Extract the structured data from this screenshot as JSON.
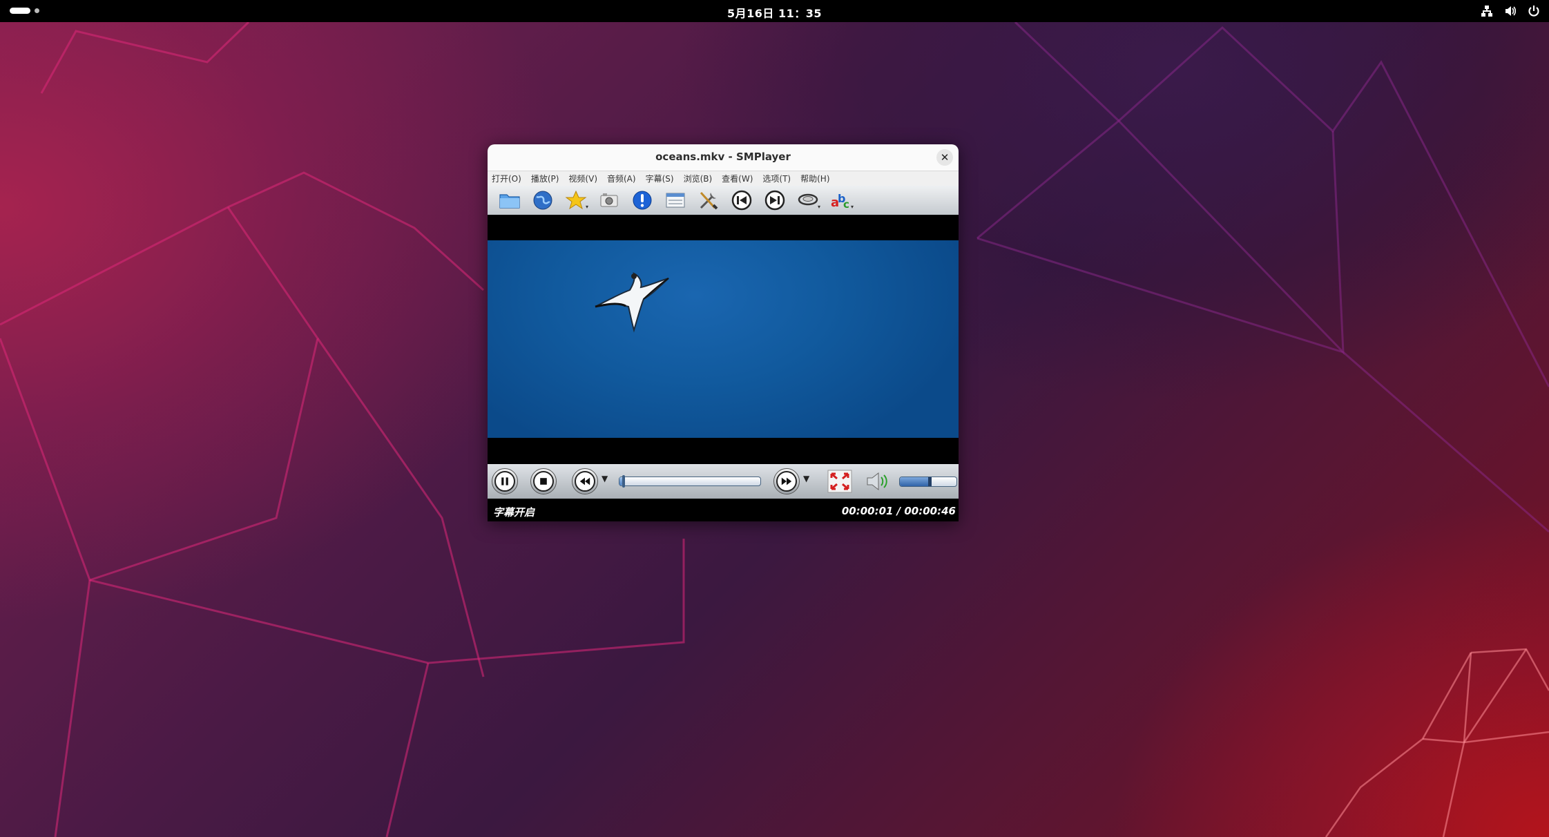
{
  "topbar": {
    "clock": "5月16日  11：35",
    "tray_icons": [
      "network-icon",
      "volume-icon",
      "power-icon"
    ]
  },
  "window": {
    "title": "oceans.mkv - SMPlayer",
    "close_label": "✕",
    "menu": [
      "打开(O)",
      "播放(P)",
      "视频(V)",
      "音频(A)",
      "字幕(S)",
      "浏览(B)",
      "查看(W)",
      "选项(T)",
      "帮助(H)"
    ],
    "toolbar_icons": [
      "open-folder-icon",
      "open-url-icon",
      "favorites-icon",
      "screenshot-icon",
      "info-icon",
      "playlist-icon",
      "preferences-icon",
      "previous-icon",
      "next-icon",
      "audio-track-icon",
      "subtitle-track-icon"
    ]
  },
  "player": {
    "seek_progress": 0.022,
    "volume_level": 0.5,
    "status_left": "字幕开启",
    "status_right": "00:00:01 / 00:00:46"
  },
  "colors": {
    "video_sky": "#115a9e",
    "accent_blue": "#4a7fc0"
  }
}
